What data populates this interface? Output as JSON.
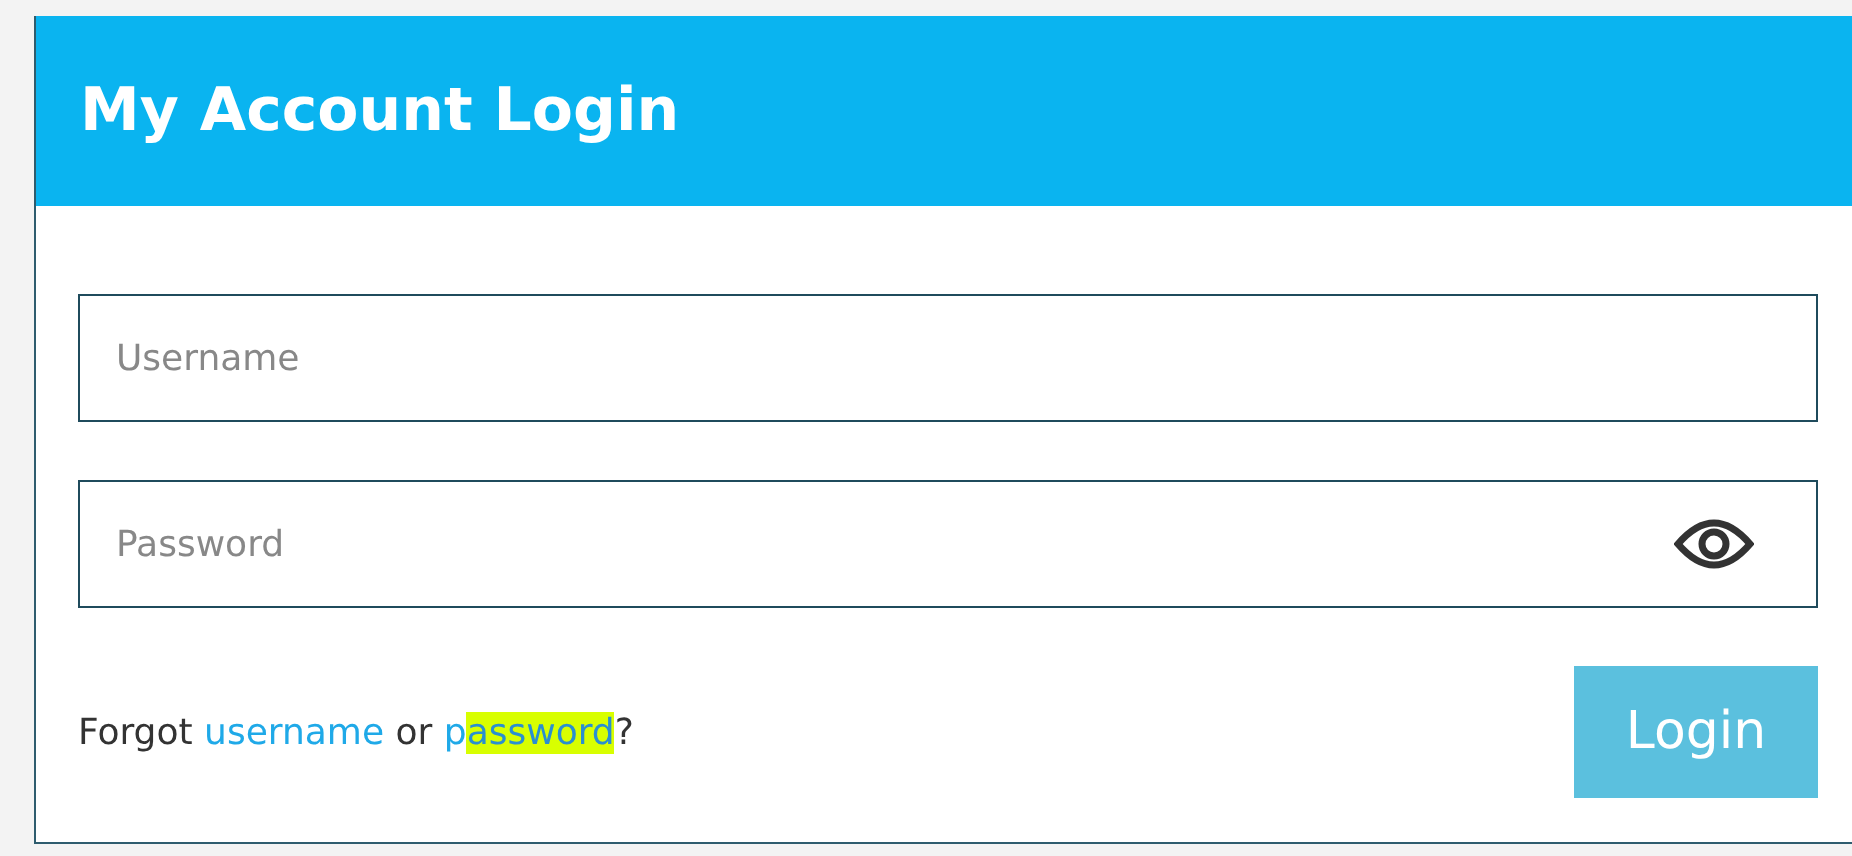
{
  "header": {
    "title": "My Account Login"
  },
  "fields": [
    {
      "kind": "text",
      "placeholder": "Username"
    },
    {
      "kind": "password",
      "placeholder": "Password"
    }
  ],
  "help": {
    "lead": "Forgot",
    "between": "or",
    "end": "?",
    "links": [
      {
        "parts": [
          {
            "text": "username",
            "highlighted": false
          }
        ]
      },
      {
        "parts": [
          {
            "text": "p",
            "highlighted": false
          },
          {
            "text": "assword",
            "highlighted": true
          }
        ]
      }
    ]
  },
  "button": {
    "label": "Login"
  }
}
